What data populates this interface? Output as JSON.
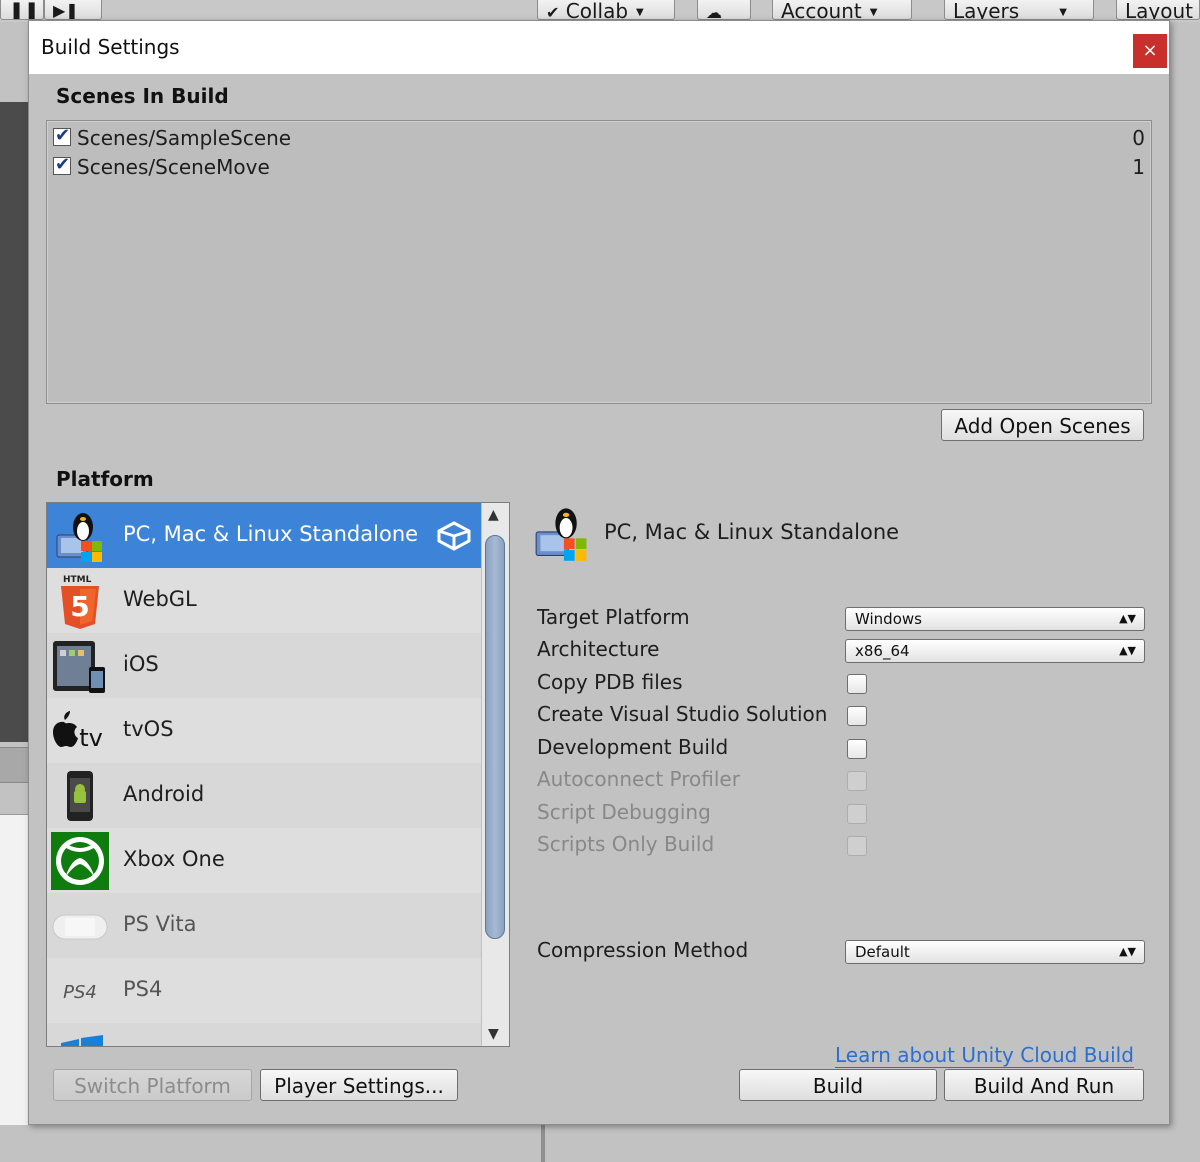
{
  "toolbar": {
    "collab_label": "Collab",
    "account_label": "Account",
    "layers_label": "Layers",
    "layout_label": "Layout"
  },
  "dialog": {
    "title": "Build Settings",
    "close_glyph": "×"
  },
  "scenes": {
    "heading": "Scenes In Build",
    "items": [
      {
        "name": "Scenes/SampleScene",
        "index": "0",
        "checked": true
      },
      {
        "name": "Scenes/SceneMove",
        "index": "1",
        "checked": true
      }
    ],
    "add_open_scenes_label": "Add Open Scenes"
  },
  "platform": {
    "heading": "Platform",
    "items": [
      {
        "label": "PC, Mac & Linux Standalone",
        "icon": "pc-mac-linux-icon",
        "selected": true,
        "current": true
      },
      {
        "label": "WebGL",
        "icon": "html5-icon",
        "sub_text": "HTML"
      },
      {
        "label": "iOS",
        "icon": "ios-device-icon"
      },
      {
        "label": "tvOS",
        "icon": "apple-tv-icon",
        "icon_text": "tv"
      },
      {
        "label": "Android",
        "icon": "android-phone-icon"
      },
      {
        "label": "Xbox One",
        "icon": "xbox-icon"
      },
      {
        "label": "PS Vita",
        "icon": "ps-vita-icon"
      },
      {
        "label": "PS4",
        "icon": "ps4-icon",
        "icon_text": "PS4"
      }
    ]
  },
  "settings": {
    "title": "PC, Mac & Linux Standalone",
    "target_platform": {
      "label": "Target Platform",
      "value": "Windows"
    },
    "architecture": {
      "label": "Architecture",
      "value": "x86_64"
    },
    "copy_pdb": {
      "label": "Copy PDB files"
    },
    "create_vs": {
      "label": "Create Visual Studio Solution"
    },
    "development_build": {
      "label": "Development Build"
    },
    "autoconnect_profiler": {
      "label": "Autoconnect Profiler"
    },
    "script_debugging": {
      "label": "Script Debugging"
    },
    "scripts_only": {
      "label": "Scripts Only Build"
    },
    "compression": {
      "label": "Compression Method",
      "value": "Default"
    },
    "cloud_link": "Learn about Unity Cloud Build"
  },
  "buttons": {
    "switch_platform": "Switch Platform",
    "player_settings": "Player Settings...",
    "build": "Build",
    "build_and_run": "Build And Run"
  },
  "colors": {
    "selection": "#3d84d8",
    "close": "#c9302c",
    "link": "#2c6fd1"
  }
}
